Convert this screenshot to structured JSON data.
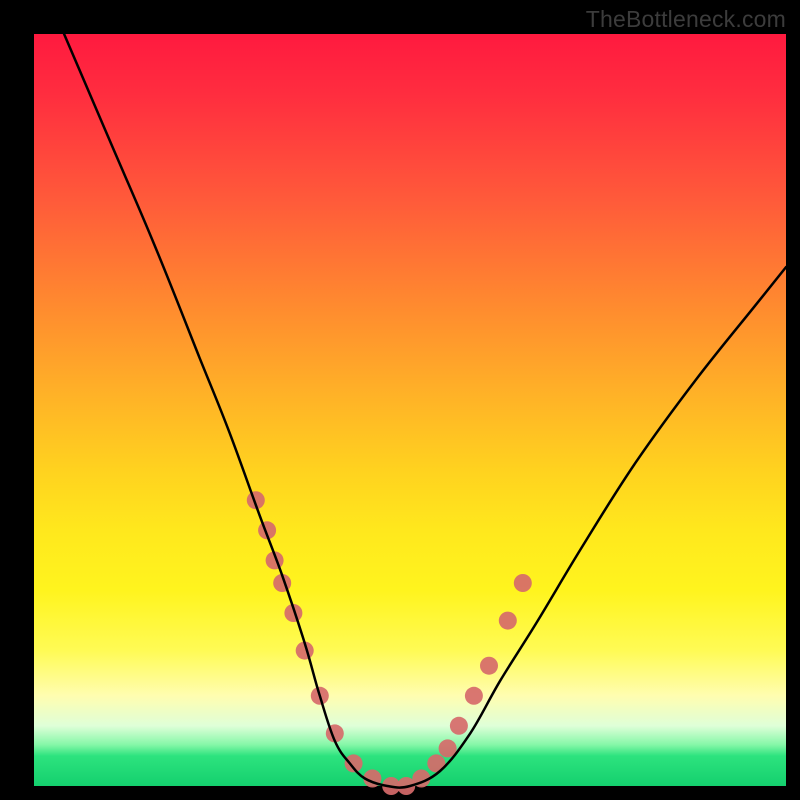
{
  "watermark": "TheBottleneck.com",
  "chart_data": {
    "type": "line",
    "title": "",
    "xlabel": "",
    "ylabel": "",
    "xlim": [
      0,
      100
    ],
    "ylim": [
      0,
      100
    ],
    "grid": false,
    "series": [
      {
        "name": "curve",
        "stroke": "#000000",
        "x": [
          4,
          10,
          16,
          22,
          26,
          30,
          33,
          36,
          38,
          40,
          42,
          44,
          47,
          50,
          54,
          58,
          62,
          67,
          73,
          80,
          88,
          96,
          100
        ],
        "values": [
          100,
          86,
          72,
          57,
          47,
          36,
          28,
          19,
          12,
          6,
          3,
          1,
          0,
          0,
          2,
          7,
          14,
          22,
          32,
          43,
          54,
          64,
          69
        ]
      }
    ],
    "markers": {
      "name": "dots",
      "fill": "#d66a6a",
      "radius_pct": 1.2,
      "x": [
        29.5,
        31,
        32,
        33,
        34.5,
        36,
        38,
        40,
        42.5,
        45,
        47.5,
        49.5,
        51.5,
        53.5,
        55,
        56.5,
        58.5,
        60.5,
        63,
        65
      ],
      "values": [
        38,
        34,
        30,
        27,
        23,
        18,
        12,
        7,
        3,
        1,
        0,
        0,
        1,
        3,
        5,
        8,
        12,
        16,
        22,
        27
      ]
    }
  }
}
